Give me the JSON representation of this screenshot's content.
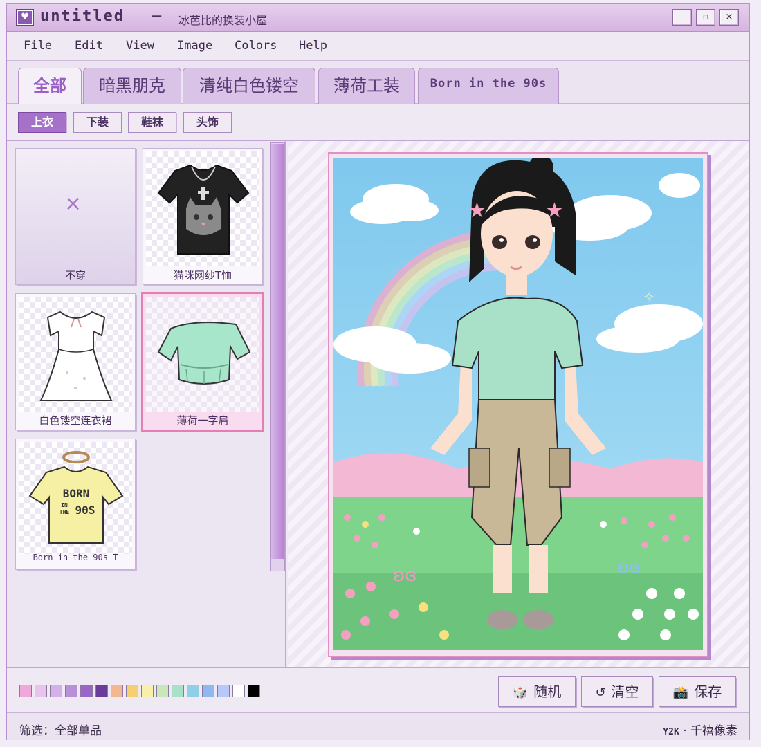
{
  "window": {
    "title": "untitled",
    "title_separator": "—",
    "subtitle": "冰芭比的换装小屋",
    "minimize_label": "_",
    "maximize_label": "▫",
    "close_label": "×"
  },
  "menu": [
    {
      "key": "F",
      "rest": "ile"
    },
    {
      "key": "E",
      "rest": "dit"
    },
    {
      "key": "V",
      "rest": "iew"
    },
    {
      "key": "I",
      "rest": "mage"
    },
    {
      "key": "C",
      "rest": "olors"
    },
    {
      "key": "H",
      "rest": "elp"
    }
  ],
  "tabs": [
    {
      "label": "全部",
      "active": true
    },
    {
      "label": "暗黑朋克",
      "active": false
    },
    {
      "label": "清纯白色镂空",
      "active": false
    },
    {
      "label": "薄荷工装",
      "active": false
    },
    {
      "label": "Born in the 90s",
      "active": false
    }
  ],
  "subtabs": [
    {
      "label": "上衣",
      "active": true
    },
    {
      "label": "下装",
      "active": false
    },
    {
      "label": "鞋袜",
      "active": false
    },
    {
      "label": "头饰",
      "active": false
    }
  ],
  "items": [
    {
      "label": "不穿",
      "icon": "×",
      "selected": false
    },
    {
      "label": "猫咪网纱T恤",
      "selected": false
    },
    {
      "label": "白色镂空连衣裙",
      "selected": false
    },
    {
      "label": "薄荷一字肩",
      "selected": true
    },
    {
      "label": "Born in the 90s T",
      "selected": false
    }
  ],
  "shirt_text": {
    "line1": "BORN",
    "line2": "IN",
    "line3": "THE",
    "line4": "90S"
  },
  "palette": [
    "#f0a8d8",
    "#e8c4ec",
    "#d4b0e8",
    "#b890d8",
    "#9a66c8",
    "#6a3d9a",
    "#f4b890",
    "#f6d070",
    "#f8f0a8",
    "#c8e8b8",
    "#a8e0c8",
    "#8ed0e8",
    "#90b8f0",
    "#b8c8f8",
    "#ffffff",
    "#000000"
  ],
  "actions": {
    "random": {
      "icon": "🎲",
      "label": "随机"
    },
    "clear": {
      "icon": "↺",
      "label": "清空"
    },
    "save": {
      "icon": "📸",
      "label": "保存"
    }
  },
  "status": {
    "filter": "筛选：全部单品",
    "credit_mono": "Y2K",
    "credit_sep": "·",
    "credit_text": "千禧像素"
  }
}
